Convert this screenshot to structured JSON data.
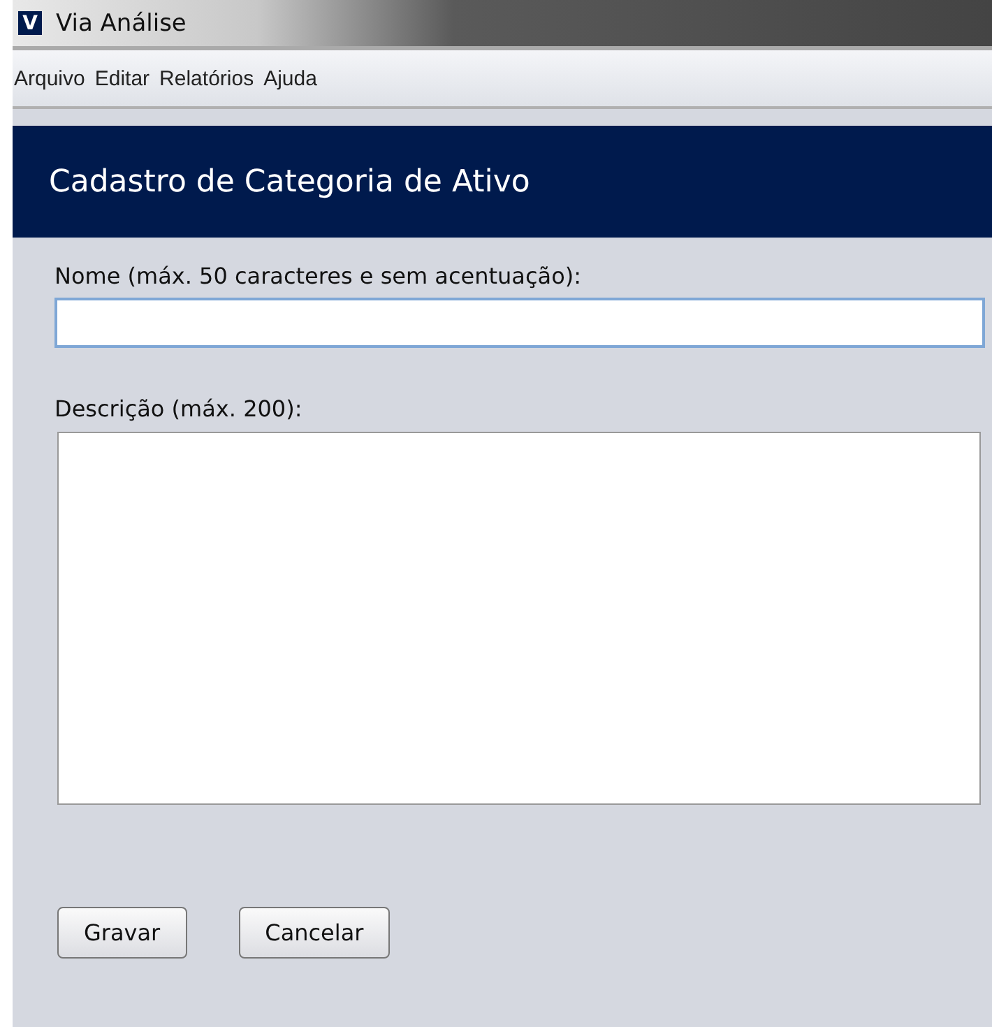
{
  "window": {
    "app_icon": "V",
    "title": "Via Análise"
  },
  "menu": [
    "Arquivo",
    "Editar",
    "Relatórios",
    "Ajuda"
  ],
  "header": {
    "title": "Cadastro de Categoria de Ativo"
  },
  "form": {
    "name_label": "Nome (máx. 50 caracteres e sem acentuação):",
    "description_label": "Descrição (máx. 200):"
  },
  "buttons": [
    "Gravar",
    "Cancelar"
  ]
}
